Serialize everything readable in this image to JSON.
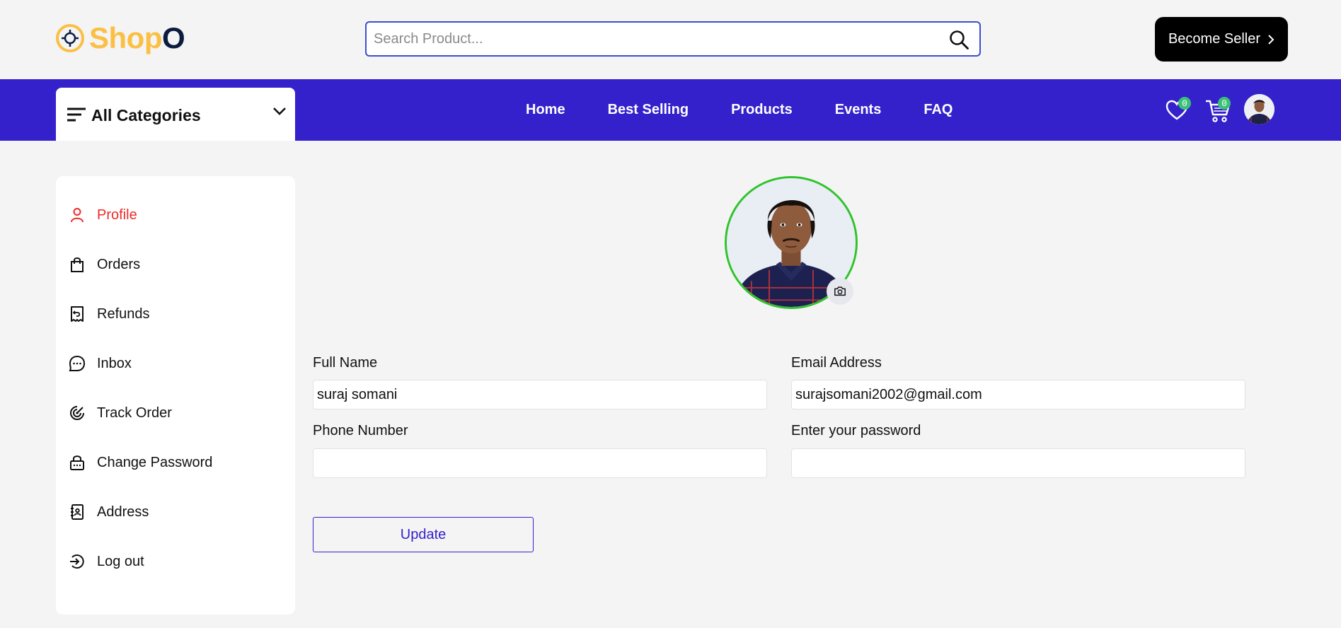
{
  "header": {
    "logo": {
      "part1": "Shop",
      "part2": "O"
    },
    "search": {
      "placeholder": "Search Product...",
      "value": ""
    },
    "become_seller_label": "Become Seller"
  },
  "navbar": {
    "categories_label": "All Categories",
    "links": [
      "Home",
      "Best Selling",
      "Products",
      "Events",
      "FAQ"
    ],
    "wishlist_count": "0",
    "cart_count": "0"
  },
  "sidebar": {
    "items": [
      {
        "label": "Profile",
        "icon": "person-icon",
        "active": true
      },
      {
        "label": "Orders",
        "icon": "shopping-bag-icon",
        "active": false
      },
      {
        "label": "Refunds",
        "icon": "receipt-refund-icon",
        "active": false
      },
      {
        "label": "Inbox",
        "icon": "chat-bubble-icon",
        "active": false
      },
      {
        "label": "Track Order",
        "icon": "track-radar-icon",
        "active": false
      },
      {
        "label": "Change Password",
        "icon": "lock-icon",
        "active": false
      },
      {
        "label": "Address",
        "icon": "address-book-icon",
        "active": false
      },
      {
        "label": "Log out",
        "icon": "logout-icon",
        "active": false
      }
    ]
  },
  "form": {
    "full_name": {
      "label": "Full Name",
      "value": "suraj somani"
    },
    "email": {
      "label": "Email Address",
      "value": "surajsomani2002@gmail.com"
    },
    "phone": {
      "label": "Phone Number",
      "value": ""
    },
    "password": {
      "label": "Enter your password",
      "value": ""
    },
    "update_label": "Update"
  },
  "colors": {
    "brand_yellow": "#fbbf44",
    "brand_navy": "#0b1c3f",
    "nav_bg": "#3421cb",
    "active_red": "#ef2a2a",
    "badge_green": "#3bc177",
    "avatar_ring": "#2fc42a"
  }
}
